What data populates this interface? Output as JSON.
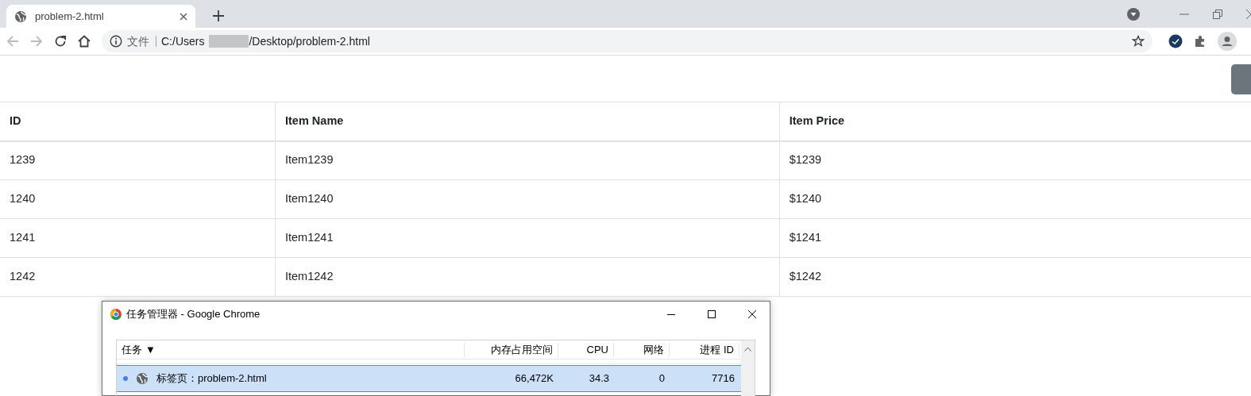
{
  "browser": {
    "tabs": [
      {
        "title": "problem-2.html",
        "selected": true
      }
    ],
    "address": {
      "security_label": "文件",
      "path_start": "C:/Users",
      "path_end": "/Desktop/problem-2.html"
    }
  },
  "table": {
    "columns": [
      "ID",
      "Item Name",
      "Item Price"
    ],
    "rows": [
      [
        "1239",
        "Item1239",
        "$1239"
      ],
      [
        "1240",
        "Item1240",
        "$1240"
      ],
      [
        "1241",
        "Item1241",
        "$1241"
      ],
      [
        "1242",
        "Item1242",
        "$1242"
      ]
    ]
  },
  "task_manager": {
    "title": "任务管理器 - Google Chrome",
    "columns": [
      "任务",
      "内存占用空间",
      "CPU",
      "网络",
      "进程 ID"
    ],
    "sort_indicator": "▼",
    "rows": [
      {
        "task": "标签页：problem-2.html",
        "memory": "66,472K",
        "cpu": "34.3",
        "network": "0",
        "pid": "7716",
        "selected": true
      }
    ]
  }
}
